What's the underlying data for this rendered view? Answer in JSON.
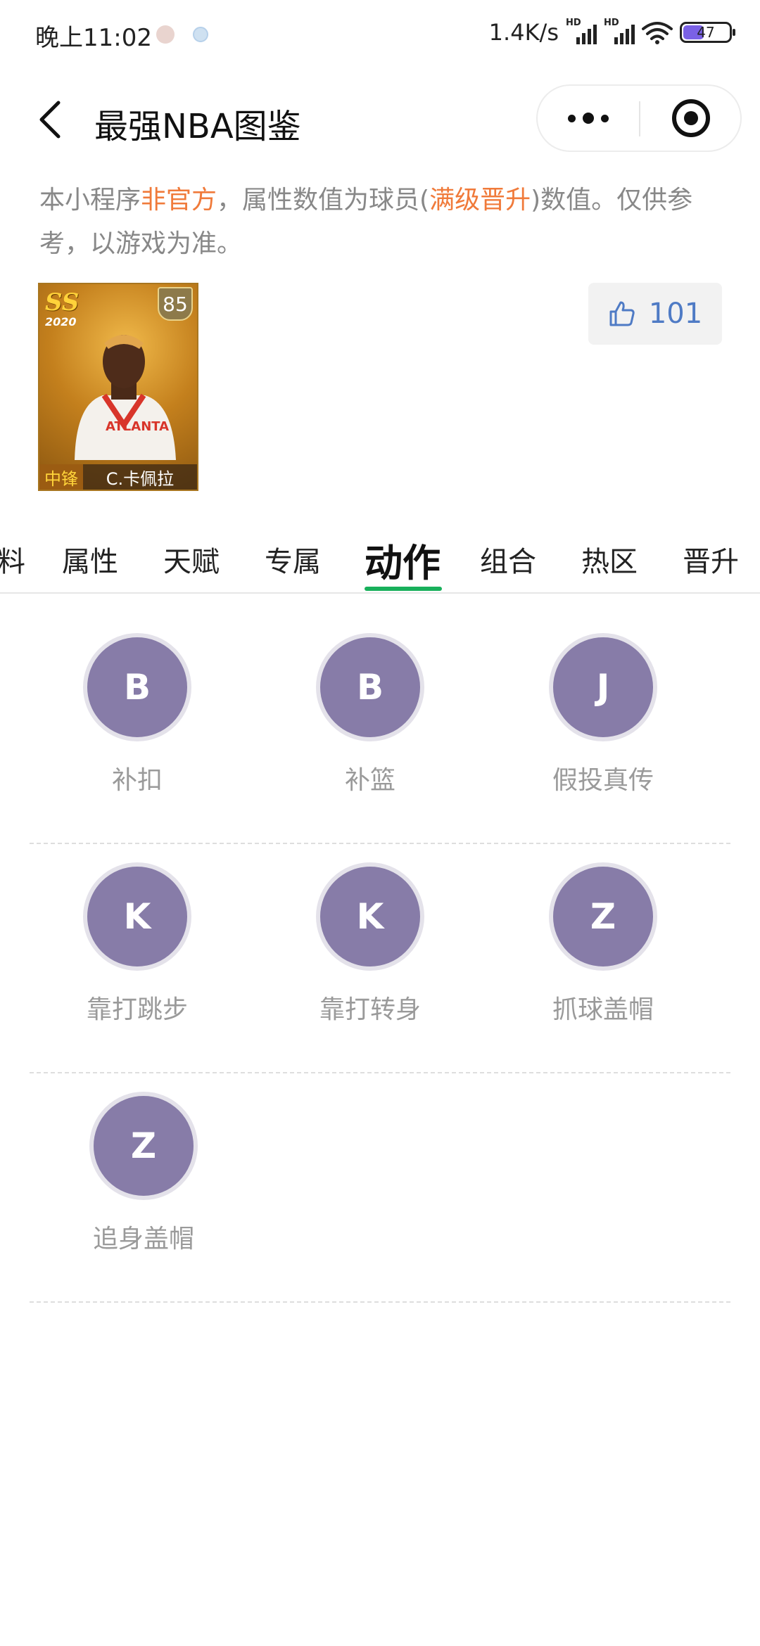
{
  "status_bar": {
    "time": "晚上11:02",
    "net_speed": "1.4K/s",
    "signal_label": "HD",
    "battery": "47"
  },
  "nav": {
    "title": "最强NBA图鉴"
  },
  "notice": {
    "part1": "本小程序",
    "highlight1": "非官方",
    "part2": "，属性数值为球员(",
    "highlight2": "满级晋升",
    "part3": ")数值。仅供参考，以游戏为准。"
  },
  "player": {
    "series": "SS",
    "season": "2020",
    "rating": "85",
    "position": "中锋",
    "name": "C.卡佩拉"
  },
  "like": {
    "count": "101"
  },
  "tabs": [
    {
      "label": "料"
    },
    {
      "label": "属性"
    },
    {
      "label": "天赋"
    },
    {
      "label": "专属"
    },
    {
      "label": "动作"
    },
    {
      "label": "组合"
    },
    {
      "label": "热区"
    },
    {
      "label": "晋升"
    }
  ],
  "active_tab": "动作",
  "actions": [
    {
      "grade": "B",
      "name": "补扣"
    },
    {
      "grade": "B",
      "name": "补篮"
    },
    {
      "grade": "J",
      "name": "假投真传"
    },
    {
      "grade": "K",
      "name": "靠打跳步"
    },
    {
      "grade": "K",
      "name": "靠打转身"
    },
    {
      "grade": "Z",
      "name": "抓球盖帽"
    },
    {
      "grade": "Z",
      "name": "追身盖帽"
    }
  ],
  "colors": {
    "accent_orange": "#f07a3a",
    "tab_indicator": "#18b05b",
    "grade_circle": "#877ca8",
    "like_text": "#4f7bc5"
  }
}
